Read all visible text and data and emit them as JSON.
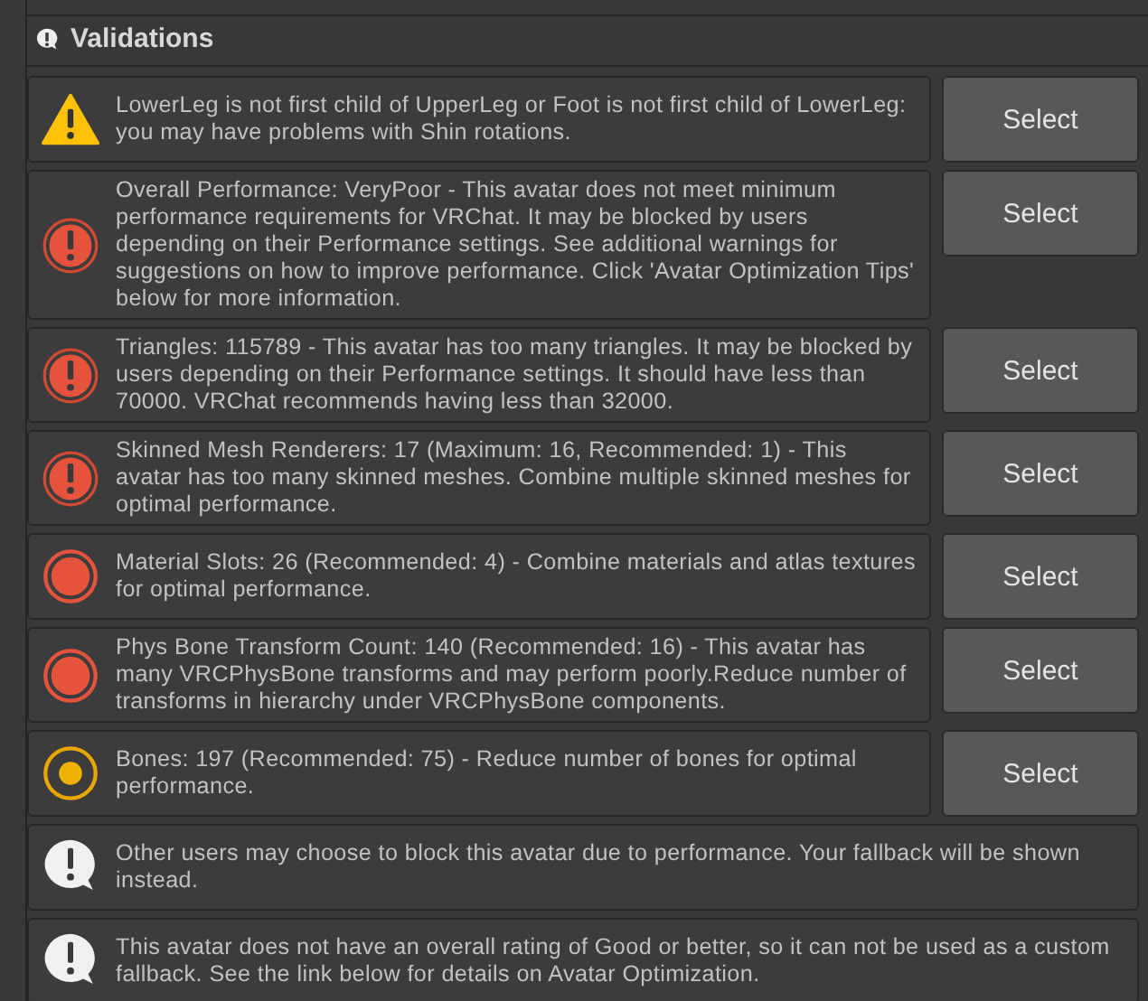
{
  "section": {
    "title": "Validations"
  },
  "messages": [
    {
      "kind": "warning",
      "text": "LowerLeg is not first child of UpperLeg or Foot is not first child of LowerLeg: you may have problems with Shin rotations.",
      "button": "Select"
    },
    {
      "kind": "error",
      "text": "Overall Performance: VeryPoor - This avatar does not meet minimum performance requirements for VRChat. It may be blocked by users depending on their Performance settings. See additional warnings for suggestions on how to improve performance. Click 'Avatar Optimization Tips' below for more information.",
      "button": "Select"
    },
    {
      "kind": "error",
      "text": "Triangles: 115789 - This avatar has too many triangles. It may be blocked by users depending on their Performance settings. It should have less than 70000. VRChat recommends having less than 32000.",
      "button": "Select"
    },
    {
      "kind": "error",
      "text": "Skinned Mesh Renderers: 17 (Maximum: 16, Recommended: 1) - This avatar has too many skinned meshes. Combine multiple skinned meshes for optimal performance.",
      "button": "Select"
    },
    {
      "kind": "poor",
      "text": "Material Slots: 26 (Recommended: 4) - Combine materials and atlas textures for optimal performance.",
      "button": "Select"
    },
    {
      "kind": "poor",
      "text": "Phys Bone Transform Count: 140 (Recommended: 16) - This avatar has many VRCPhysBone transforms and may perform poorly.Reduce number of transforms in hierarchy under VRCPhysBone components.",
      "button": "Select"
    },
    {
      "kind": "medium",
      "text": "Bones: 197 (Recommended: 75) - Reduce number of bones for optimal performance.",
      "button": "Select"
    },
    {
      "kind": "info",
      "text": "Other users may choose to block this avatar due to performance. Your fallback will be shown instead."
    },
    {
      "kind": "info",
      "text": "This avatar does not have an overall rating of Good or better, so it can not be used as a custom fallback. See the link below for details on Avatar Optimization."
    }
  ]
}
